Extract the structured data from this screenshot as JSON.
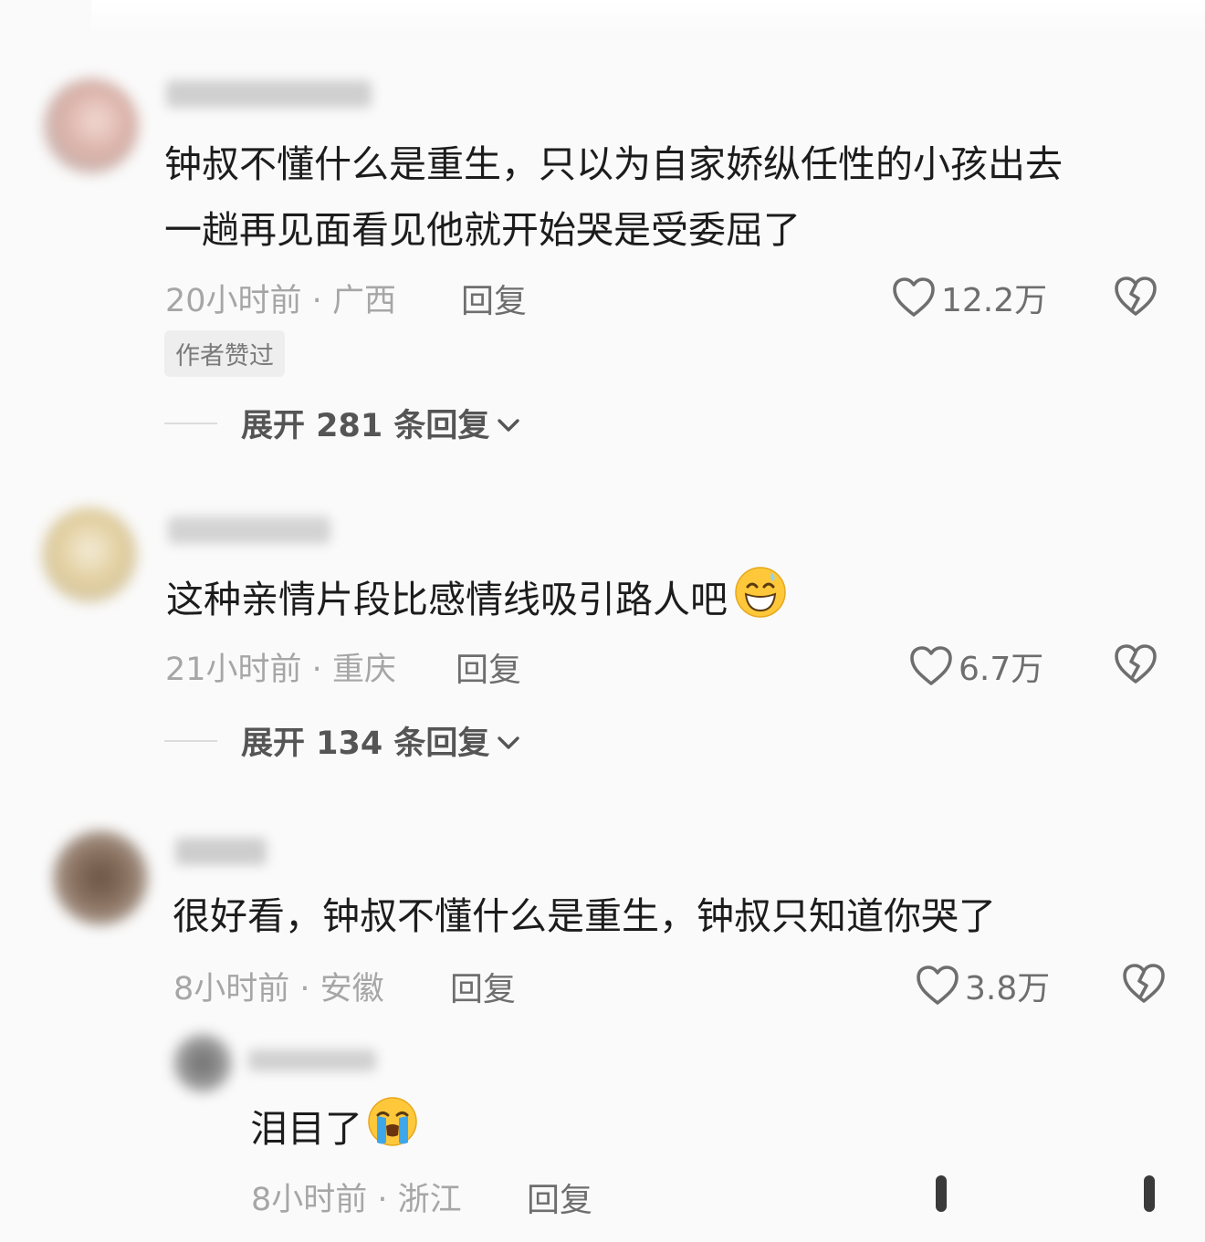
{
  "comments": [
    {
      "text_line1": "钟叔不懂什么是重生，只以为自家娇纵任性的小孩出去",
      "text_line2": "一趟再见面看见他就开始哭是受委屈了",
      "time": "20小时前",
      "location": "广西",
      "reply": "回复",
      "likes": "12.2万",
      "badge": "作者赞过",
      "expand_label": "展开 281 条回复"
    },
    {
      "text": "这种亲情片段比感情线吸引路人吧",
      "emoji": "grinning-sweat-emoji",
      "time": "21小时前",
      "location": "重庆",
      "reply": "回复",
      "likes": "6.7万",
      "expand_label": "展开 134 条回复"
    },
    {
      "text": "很好看，钟叔不懂什么是重生，钟叔只知道你哭了",
      "time": "8小时前",
      "location": "安徽",
      "reply": "回复",
      "likes": "3.8万",
      "sub_reply": {
        "text": "泪目了",
        "emoji": "loudly-crying-emoji",
        "time": "8小时前",
        "location": "浙江",
        "reply": "回复"
      }
    }
  ],
  "separator": " · ",
  "icons": {
    "like": "heart-icon",
    "dislike": "broken-heart-icon",
    "expand": "chevron-down-icon"
  },
  "colors": {
    "background": "#fafafa",
    "text": "#1c1c1c",
    "meta": "#a6a6a6"
  }
}
